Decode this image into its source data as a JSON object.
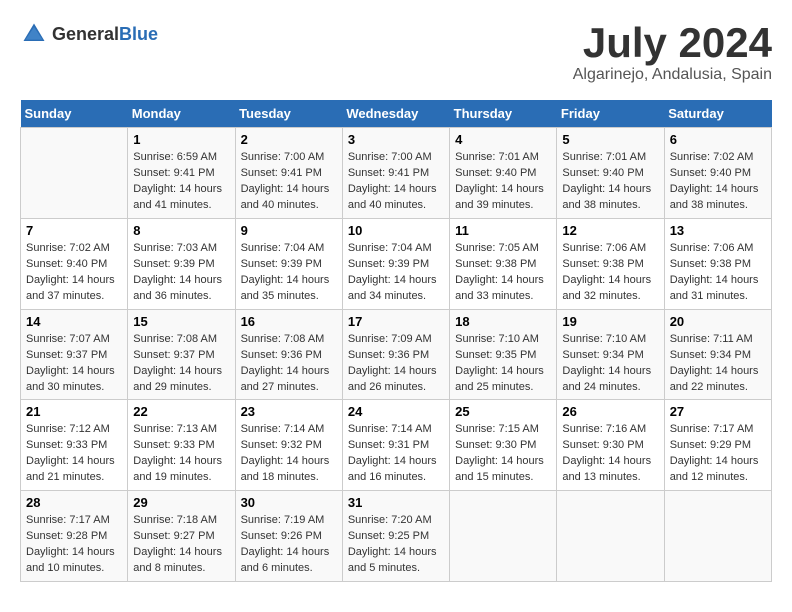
{
  "logo": {
    "general": "General",
    "blue": "Blue"
  },
  "title": "July 2024",
  "subtitle": "Algarinejo, Andalusia, Spain",
  "weekdays": [
    "Sunday",
    "Monday",
    "Tuesday",
    "Wednesday",
    "Thursday",
    "Friday",
    "Saturday"
  ],
  "rows": [
    [
      {
        "num": "",
        "sunrise": "",
        "sunset": "",
        "daylight": ""
      },
      {
        "num": "1",
        "sunrise": "Sunrise: 6:59 AM",
        "sunset": "Sunset: 9:41 PM",
        "daylight": "Daylight: 14 hours and 41 minutes."
      },
      {
        "num": "2",
        "sunrise": "Sunrise: 7:00 AM",
        "sunset": "Sunset: 9:41 PM",
        "daylight": "Daylight: 14 hours and 40 minutes."
      },
      {
        "num": "3",
        "sunrise": "Sunrise: 7:00 AM",
        "sunset": "Sunset: 9:41 PM",
        "daylight": "Daylight: 14 hours and 40 minutes."
      },
      {
        "num": "4",
        "sunrise": "Sunrise: 7:01 AM",
        "sunset": "Sunset: 9:40 PM",
        "daylight": "Daylight: 14 hours and 39 minutes."
      },
      {
        "num": "5",
        "sunrise": "Sunrise: 7:01 AM",
        "sunset": "Sunset: 9:40 PM",
        "daylight": "Daylight: 14 hours and 38 minutes."
      },
      {
        "num": "6",
        "sunrise": "Sunrise: 7:02 AM",
        "sunset": "Sunset: 9:40 PM",
        "daylight": "Daylight: 14 hours and 38 minutes."
      }
    ],
    [
      {
        "num": "7",
        "sunrise": "Sunrise: 7:02 AM",
        "sunset": "Sunset: 9:40 PM",
        "daylight": "Daylight: 14 hours and 37 minutes."
      },
      {
        "num": "8",
        "sunrise": "Sunrise: 7:03 AM",
        "sunset": "Sunset: 9:39 PM",
        "daylight": "Daylight: 14 hours and 36 minutes."
      },
      {
        "num": "9",
        "sunrise": "Sunrise: 7:04 AM",
        "sunset": "Sunset: 9:39 PM",
        "daylight": "Daylight: 14 hours and 35 minutes."
      },
      {
        "num": "10",
        "sunrise": "Sunrise: 7:04 AM",
        "sunset": "Sunset: 9:39 PM",
        "daylight": "Daylight: 14 hours and 34 minutes."
      },
      {
        "num": "11",
        "sunrise": "Sunrise: 7:05 AM",
        "sunset": "Sunset: 9:38 PM",
        "daylight": "Daylight: 14 hours and 33 minutes."
      },
      {
        "num": "12",
        "sunrise": "Sunrise: 7:06 AM",
        "sunset": "Sunset: 9:38 PM",
        "daylight": "Daylight: 14 hours and 32 minutes."
      },
      {
        "num": "13",
        "sunrise": "Sunrise: 7:06 AM",
        "sunset": "Sunset: 9:38 PM",
        "daylight": "Daylight: 14 hours and 31 minutes."
      }
    ],
    [
      {
        "num": "14",
        "sunrise": "Sunrise: 7:07 AM",
        "sunset": "Sunset: 9:37 PM",
        "daylight": "Daylight: 14 hours and 30 minutes."
      },
      {
        "num": "15",
        "sunrise": "Sunrise: 7:08 AM",
        "sunset": "Sunset: 9:37 PM",
        "daylight": "Daylight: 14 hours and 29 minutes."
      },
      {
        "num": "16",
        "sunrise": "Sunrise: 7:08 AM",
        "sunset": "Sunset: 9:36 PM",
        "daylight": "Daylight: 14 hours and 27 minutes."
      },
      {
        "num": "17",
        "sunrise": "Sunrise: 7:09 AM",
        "sunset": "Sunset: 9:36 PM",
        "daylight": "Daylight: 14 hours and 26 minutes."
      },
      {
        "num": "18",
        "sunrise": "Sunrise: 7:10 AM",
        "sunset": "Sunset: 9:35 PM",
        "daylight": "Daylight: 14 hours and 25 minutes."
      },
      {
        "num": "19",
        "sunrise": "Sunrise: 7:10 AM",
        "sunset": "Sunset: 9:34 PM",
        "daylight": "Daylight: 14 hours and 24 minutes."
      },
      {
        "num": "20",
        "sunrise": "Sunrise: 7:11 AM",
        "sunset": "Sunset: 9:34 PM",
        "daylight": "Daylight: 14 hours and 22 minutes."
      }
    ],
    [
      {
        "num": "21",
        "sunrise": "Sunrise: 7:12 AM",
        "sunset": "Sunset: 9:33 PM",
        "daylight": "Daylight: 14 hours and 21 minutes."
      },
      {
        "num": "22",
        "sunrise": "Sunrise: 7:13 AM",
        "sunset": "Sunset: 9:33 PM",
        "daylight": "Daylight: 14 hours and 19 minutes."
      },
      {
        "num": "23",
        "sunrise": "Sunrise: 7:14 AM",
        "sunset": "Sunset: 9:32 PM",
        "daylight": "Daylight: 14 hours and 18 minutes."
      },
      {
        "num": "24",
        "sunrise": "Sunrise: 7:14 AM",
        "sunset": "Sunset: 9:31 PM",
        "daylight": "Daylight: 14 hours and 16 minutes."
      },
      {
        "num": "25",
        "sunrise": "Sunrise: 7:15 AM",
        "sunset": "Sunset: 9:30 PM",
        "daylight": "Daylight: 14 hours and 15 minutes."
      },
      {
        "num": "26",
        "sunrise": "Sunrise: 7:16 AM",
        "sunset": "Sunset: 9:30 PM",
        "daylight": "Daylight: 14 hours and 13 minutes."
      },
      {
        "num": "27",
        "sunrise": "Sunrise: 7:17 AM",
        "sunset": "Sunset: 9:29 PM",
        "daylight": "Daylight: 14 hours and 12 minutes."
      }
    ],
    [
      {
        "num": "28",
        "sunrise": "Sunrise: 7:17 AM",
        "sunset": "Sunset: 9:28 PM",
        "daylight": "Daylight: 14 hours and 10 minutes."
      },
      {
        "num": "29",
        "sunrise": "Sunrise: 7:18 AM",
        "sunset": "Sunset: 9:27 PM",
        "daylight": "Daylight: 14 hours and 8 minutes."
      },
      {
        "num": "30",
        "sunrise": "Sunrise: 7:19 AM",
        "sunset": "Sunset: 9:26 PM",
        "daylight": "Daylight: 14 hours and 6 minutes."
      },
      {
        "num": "31",
        "sunrise": "Sunrise: 7:20 AM",
        "sunset": "Sunset: 9:25 PM",
        "daylight": "Daylight: 14 hours and 5 minutes."
      },
      {
        "num": "",
        "sunrise": "",
        "sunset": "",
        "daylight": ""
      },
      {
        "num": "",
        "sunrise": "",
        "sunset": "",
        "daylight": ""
      },
      {
        "num": "",
        "sunrise": "",
        "sunset": "",
        "daylight": ""
      }
    ]
  ]
}
